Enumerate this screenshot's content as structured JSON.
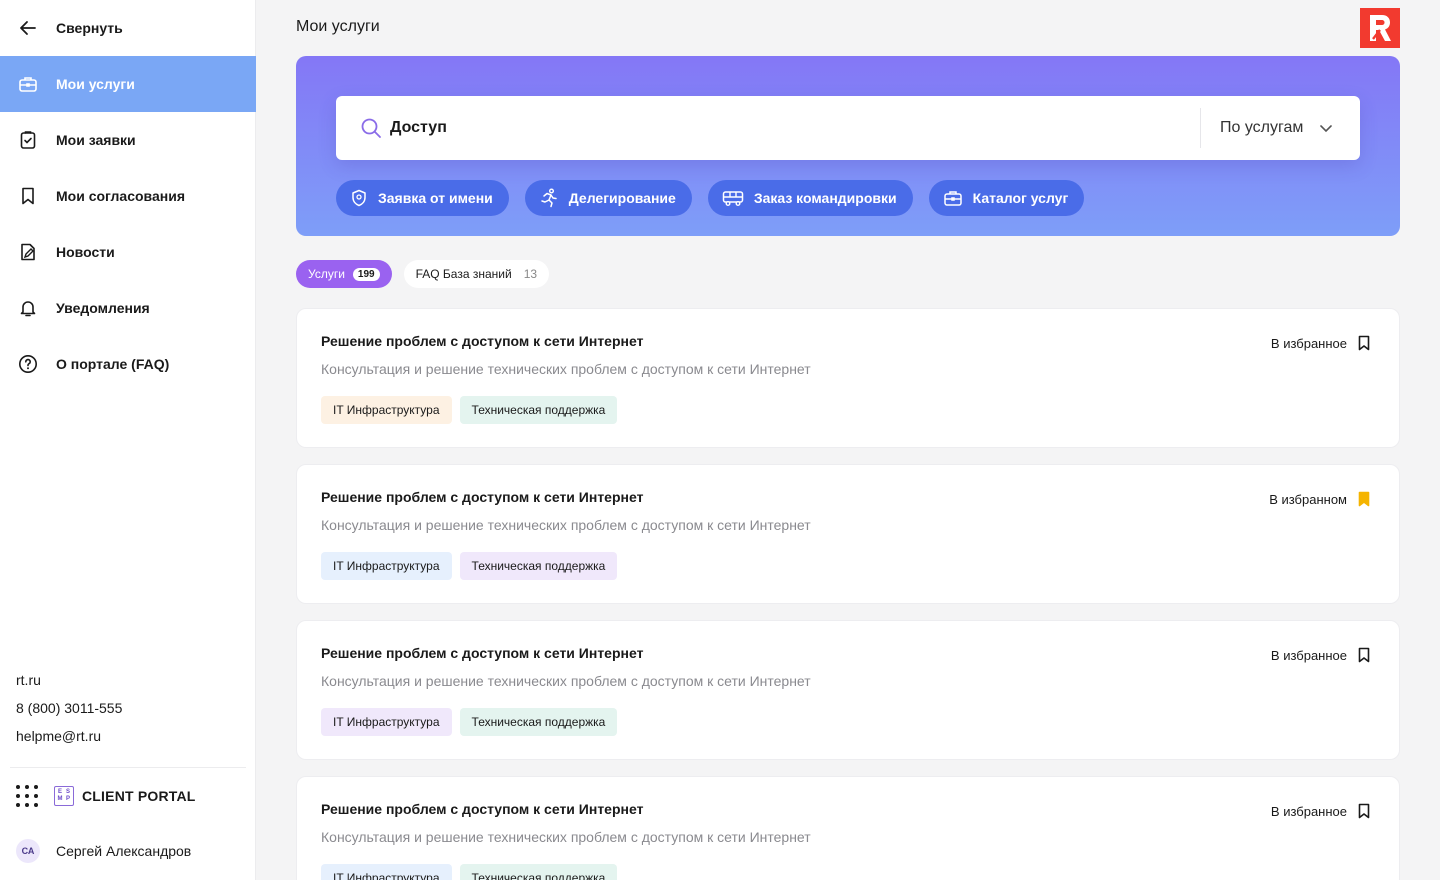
{
  "sidebar": {
    "collapse_label": "Свернуть",
    "items": [
      {
        "label": "Мои услуги",
        "icon": "briefcase-icon",
        "active": true
      },
      {
        "label": "Мои заявки",
        "icon": "clipboard-check-icon",
        "active": false
      },
      {
        "label": "Мои согласования",
        "icon": "bookmark-icon",
        "active": false
      },
      {
        "label": "Новости",
        "icon": "document-edit-icon",
        "active": false
      },
      {
        "label": "Уведомления",
        "icon": "bell-icon",
        "active": false
      },
      {
        "label": "О портале (FAQ)",
        "icon": "question-circle-icon",
        "active": false
      }
    ],
    "contacts": {
      "site": "rt.ru",
      "phone": "8 (800) 3011-555",
      "email": "helpme@rt.ru"
    },
    "portal": {
      "logo_letters": [
        "E",
        "S",
        "M",
        "P"
      ],
      "name": "CLIENT PORTAL"
    },
    "user": {
      "initials": "СА",
      "name": "Сергей Александров"
    }
  },
  "header": {
    "title": "Мои услуги"
  },
  "search": {
    "value": "Доступ",
    "scope": "По услугам"
  },
  "quick_actions": [
    {
      "label": "Заявка от имени",
      "icon": "shield-user-icon"
    },
    {
      "label": "Делегирование",
      "icon": "running-person-icon"
    },
    {
      "label": "Заказ командировки",
      "icon": "bus-icon"
    },
    {
      "label": "Каталог услуг",
      "icon": "briefcase-icon"
    }
  ],
  "tabs": [
    {
      "label": "Услуги",
      "count": "199",
      "active": true
    },
    {
      "label": "FAQ База знаний",
      "count": "13",
      "active": false
    }
  ],
  "cards": [
    {
      "title": "Решение проблем с доступом к сети Интернет",
      "description": "Консультация и решение технических проблем с доступом к сети Интернет",
      "favorite_label": "В избранное",
      "favorited": false,
      "tags": [
        {
          "label": "IT Инфраструктура",
          "color": "#fdf1e3"
        },
        {
          "label": "Техническая поддержка",
          "color": "#e4f4ef"
        }
      ]
    },
    {
      "title": "Решение проблем с доступом к сети Интернет",
      "description": "Консультация и решение технических проблем с доступом к сети Интернет",
      "favorite_label": "В избранном",
      "favorited": true,
      "tags": [
        {
          "label": "IT Инфраструктура",
          "color": "#e6f0fd"
        },
        {
          "label": "Техническая поддержка",
          "color": "#f0e8fb"
        }
      ]
    },
    {
      "title": "Решение проблем с доступом к сети Интернет",
      "description": "Консультация и решение технических проблем с доступом к сети Интернет",
      "favorite_label": "В избранное",
      "favorited": false,
      "tags": [
        {
          "label": "IT Инфраструктура",
          "color": "#f0e8fb"
        },
        {
          "label": "Техническая поддержка",
          "color": "#e4f4ef"
        }
      ]
    },
    {
      "title": "Решение проблем с доступом к сети Интернет",
      "description": "Консультация и решение технических проблем с доступом к сети Интернет",
      "favorite_label": "В избранное",
      "favorited": false,
      "tags": [
        {
          "label": "IT Инфраструктура",
          "color": "#e6f0fd"
        },
        {
          "label": "Техническая поддержка",
          "color": "#e4f4ef"
        }
      ]
    }
  ],
  "colors": {
    "accent": "#7aa7f5",
    "chip": "#4a6ce8",
    "tab_active": "#9a62f0",
    "favorite_active": "#f5b400",
    "brand_logo": "#f23a2f"
  }
}
